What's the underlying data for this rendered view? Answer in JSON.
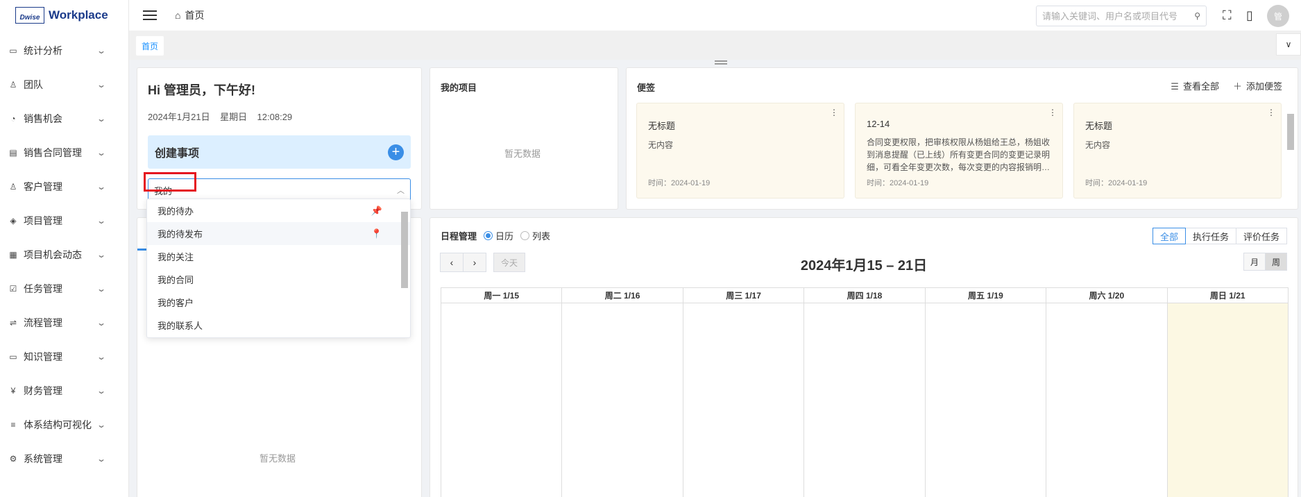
{
  "logo": {
    "mark": "Dwise",
    "text": "Workplace"
  },
  "sidebar": {
    "items": [
      {
        "label": "统计分析",
        "icon": "chart-icon"
      },
      {
        "label": "团队",
        "icon": "team-icon"
      },
      {
        "label": "销售机会",
        "icon": "pie-icon"
      },
      {
        "label": "销售合同管理",
        "icon": "contract-icon"
      },
      {
        "label": "客户管理",
        "icon": "customer-icon"
      },
      {
        "label": "项目管理",
        "icon": "layers-icon"
      },
      {
        "label": "项目机会动态",
        "icon": "calendar-icon"
      },
      {
        "label": "任务管理",
        "icon": "task-icon"
      },
      {
        "label": "流程管理",
        "icon": "flow-icon"
      },
      {
        "label": "知识管理",
        "icon": "book-icon"
      },
      {
        "label": "财务管理",
        "icon": "finance-icon"
      },
      {
        "label": "体系结构可视化",
        "icon": "list-icon"
      },
      {
        "label": "系统管理",
        "icon": "gear-icon"
      }
    ]
  },
  "header": {
    "breadcrumb": "首页",
    "search_placeholder": "请输入关键词、用户名或项目代号",
    "avatar_text": "管"
  },
  "tabs": {
    "home": "首页"
  },
  "greeting": {
    "title": "Hi 管理员，下午好!",
    "date": "2024年1月21日",
    "weekday": "星期日",
    "time": "12:08:29",
    "create_label": "创建事项",
    "select_value": "我的"
  },
  "dropdown": {
    "options": [
      {
        "label": "我的待办",
        "pinned": true
      },
      {
        "label": "我的待发布",
        "pinned": true
      },
      {
        "label": "我的关注",
        "pinned": false
      },
      {
        "label": "我的合同",
        "pinned": false
      },
      {
        "label": "我的客户",
        "pinned": false
      },
      {
        "label": "我的联系人",
        "pinned": false
      }
    ]
  },
  "left_lower": {
    "empty": "暂无数据"
  },
  "projects": {
    "title": "我的项目",
    "empty": "暂无数据"
  },
  "notes": {
    "title": "便签",
    "view_all": "查看全部",
    "add": "添加便签",
    "items": [
      {
        "title": "无标题",
        "body": "无内容",
        "time": "时间：2024-01-19"
      },
      {
        "title": "12-14",
        "body": "合同变更权限，把审核权限从杨姐给王总，杨姐收到消息提醒（已上线）所有变更合同的变更记录明细，可看全年变更次数，每次变更的内容报销明…",
        "time": "时间：2024-01-19"
      },
      {
        "title": "无标题",
        "body": "无内容",
        "time": "时间：2024-01-19"
      }
    ]
  },
  "schedule": {
    "title": "日程管理",
    "radio_calendar": "日历",
    "radio_list": "列表",
    "filters": [
      "全部",
      "执行任务",
      "评价任务"
    ],
    "today": "今天",
    "week_title": "2024年1月15 – 21日",
    "view_month": "月",
    "view_week": "周",
    "days": [
      "周一 1/15",
      "周二 1/16",
      "周三 1/17",
      "周四 1/18",
      "周五 1/19",
      "周六 1/20",
      "周日 1/21"
    ]
  },
  "colors": {
    "accent": "#3a8ee6",
    "annotation": "#e5141e",
    "today_column": "#fcf8e3",
    "note_bg": "#fdf9ee"
  }
}
